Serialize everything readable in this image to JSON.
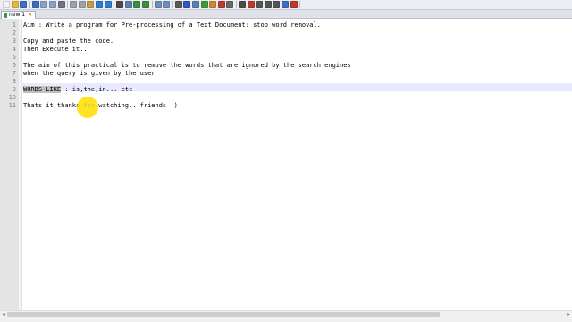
{
  "app": {
    "tab_label": "new 1",
    "tab_close_glyph": "×"
  },
  "toolbar": {
    "icons": [
      {
        "name": "new-file-icon",
        "color": "#f3f3f3"
      },
      {
        "name": "open-file-icon",
        "color": "#e7b93a"
      },
      {
        "name": "save-icon",
        "color": "#3b6fc4"
      },
      {
        "name": "save-all-icon",
        "color": "#3b6fc4"
      },
      {
        "name": "close-icon",
        "color": "#8aa0c9"
      },
      {
        "name": "close-all-icon",
        "color": "#8aa0c9"
      },
      {
        "name": "print-icon",
        "color": "#6f7680"
      },
      {
        "name": "cut-icon",
        "color": "#9aa3ad"
      },
      {
        "name": "copy-icon",
        "color": "#9aa3ad"
      },
      {
        "name": "paste-icon",
        "color": "#c79a48"
      },
      {
        "name": "undo-icon",
        "color": "#2f7bd1"
      },
      {
        "name": "redo-icon",
        "color": "#2f7bd1"
      },
      {
        "name": "find-icon",
        "color": "#4b4b4b"
      },
      {
        "name": "replace-icon",
        "color": "#5c7fb4"
      },
      {
        "name": "zoom-in-icon",
        "color": "#3a8f3a"
      },
      {
        "name": "zoom-out-icon",
        "color": "#3a8f3a"
      },
      {
        "name": "sync-vertical-icon",
        "color": "#6e8fb8"
      },
      {
        "name": "sync-horizontal-icon",
        "color": "#6e8fb8"
      },
      {
        "name": "word-wrap-icon",
        "color": "#5a5a5a"
      },
      {
        "name": "show-all-chars-icon",
        "color": "#2e57c9"
      },
      {
        "name": "indent-guide-icon",
        "color": "#5a7fb4"
      },
      {
        "name": "user-language-icon",
        "color": "#3c9c3c"
      },
      {
        "name": "doc-map-icon",
        "color": "#cc8a2f"
      },
      {
        "name": "function-list-icon",
        "color": "#c0392b"
      },
      {
        "name": "folder-workspace-icon",
        "color": "#6a6a6a"
      },
      {
        "name": "monitor-icon",
        "color": "#4b4b4b"
      },
      {
        "name": "record-macro-icon",
        "color": "#c0392b"
      },
      {
        "name": "stop-macro-icon",
        "color": "#555555"
      },
      {
        "name": "play-macro-icon",
        "color": "#555555"
      },
      {
        "name": "play-multiple-icon",
        "color": "#555555"
      },
      {
        "name": "save-macro-icon",
        "color": "#3b6fc4"
      },
      {
        "name": "spell-check-icon",
        "color": "#c0392b"
      }
    ]
  },
  "editor": {
    "lines": [
      {
        "n": "1",
        "t": "Aim : Write a program for Pre-processing of a Text Document: stop word removal."
      },
      {
        "n": "2",
        "t": ""
      },
      {
        "n": "3",
        "t": "Copy and paste the code."
      },
      {
        "n": "4",
        "t": "Then Execute it.."
      },
      {
        "n": "5",
        "t": ""
      },
      {
        "n": "6",
        "t": "The aim of this practical is to remove the words that are ignored by the search engines"
      },
      {
        "n": "7",
        "t": "when the query is given by the user"
      },
      {
        "n": "8",
        "t": ""
      },
      {
        "n": "9",
        "sel": "WORDS LIKE",
        "t": " : is,the,in... etc"
      },
      {
        "n": "10",
        "t": ""
      },
      {
        "n": "11",
        "t": "Thats it thanks for watching.. friends :)"
      }
    ],
    "cursor_highlight_color": "#ffde00"
  },
  "scrollbar": {
    "left_glyph": "◂",
    "right_glyph": "▸"
  }
}
